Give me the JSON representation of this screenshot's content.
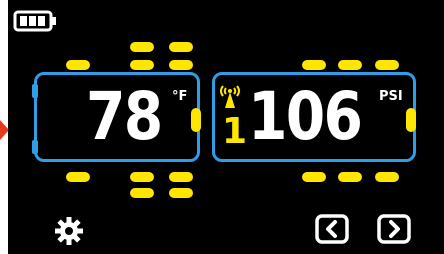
{
  "status": {
    "battery_icon": "battery-icon",
    "signal_icon": "wireless-signal-icon"
  },
  "temperature": {
    "value": "78",
    "unit": "°F"
  },
  "pressure": {
    "tire_index": "1",
    "value": "106",
    "unit": "PSI"
  },
  "controls": {
    "settings_icon": "gear-icon",
    "prev_icon": "chevron-left-icon",
    "next_icon": "chevron-right-icon"
  },
  "colors": {
    "background": "#000000",
    "accent_blue": "#2f9ee6",
    "indicator_yellow": "#ffe600",
    "text_white": "#ffffff",
    "alert_red": "#e63a1e"
  }
}
